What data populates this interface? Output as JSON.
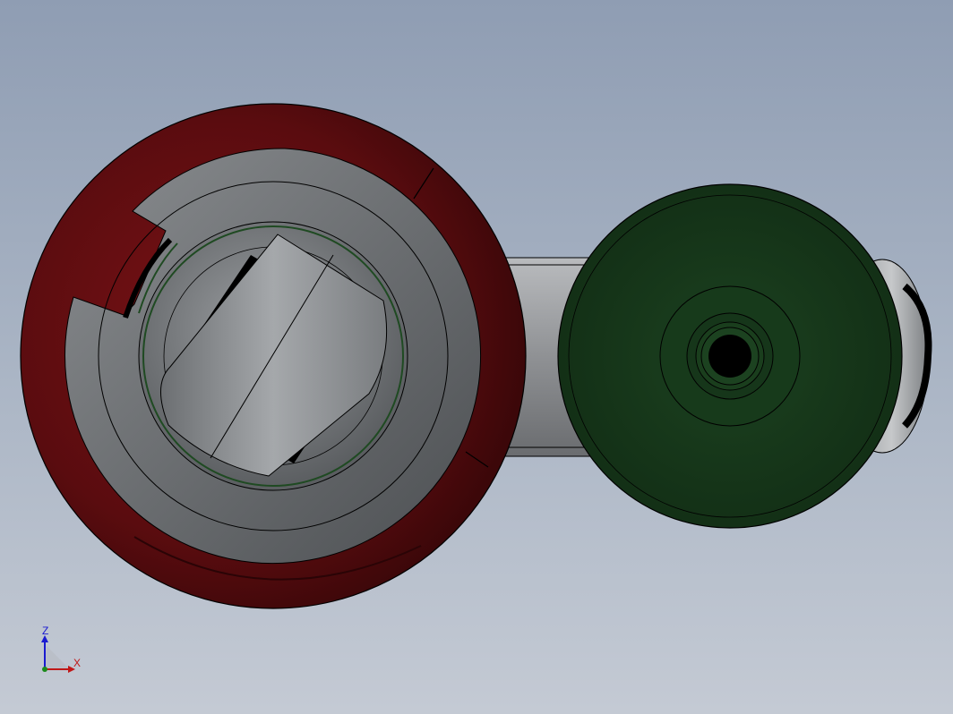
{
  "triad": {
    "z_label": "Z",
    "x_label": "X",
    "colors": {
      "z": "#1a1ad0",
      "x": "#c01818",
      "origin": "#1a8a1a"
    }
  },
  "model": {
    "colors": {
      "background_top": "#8f9db3",
      "background_bottom": "#c4cad4",
      "red_wheel": "#5a0d10",
      "grey_hub": "#6a6d70",
      "green_disc": "#183a1c",
      "arm": "#8b8d90",
      "edge": "#000000"
    }
  }
}
